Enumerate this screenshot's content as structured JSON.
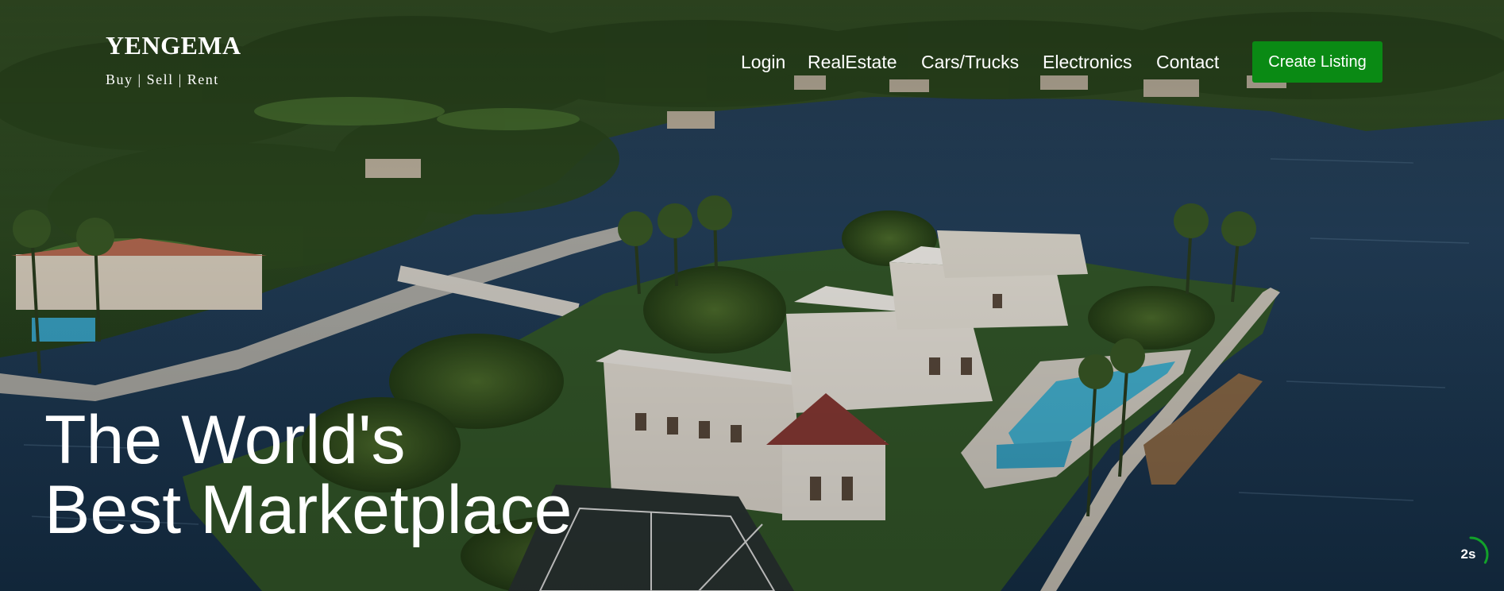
{
  "brand": {
    "name": "YENGEMA",
    "tagline": "Buy | Sell | Rent"
  },
  "nav": {
    "items": [
      {
        "label": "Login"
      },
      {
        "label": "RealEstate"
      },
      {
        "label": "Cars/Trucks"
      },
      {
        "label": "Electronics"
      },
      {
        "label": "Contact"
      }
    ],
    "cta_label": "Create Listing",
    "cta_color": "#0a8a14"
  },
  "hero": {
    "headline_line1": "The World's",
    "headline_line2": "Best Marketplace",
    "background_image": "aerial-waterfront-estate"
  },
  "slider_timer": {
    "label": "2s",
    "progress": 0.33,
    "accent_color": "#12a12a"
  }
}
